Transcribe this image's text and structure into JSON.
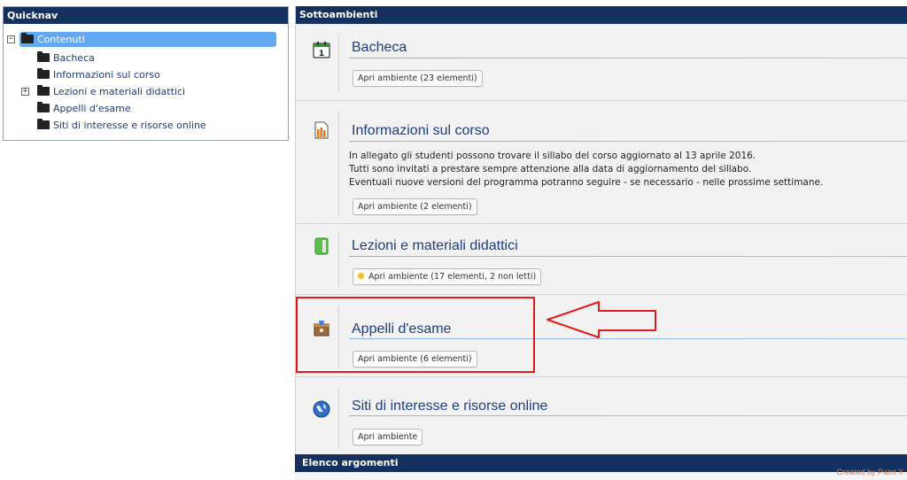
{
  "quicknav": {
    "title": "Quicknav",
    "items": [
      {
        "label": "Contenuti",
        "expander": "−"
      },
      {
        "label": "Bacheca"
      },
      {
        "label": "Informazioni sul corso"
      },
      {
        "label": "Lezioni e materiali didattici",
        "expander": "+"
      },
      {
        "label": "Appelli d'esame"
      },
      {
        "label": "Siti di interesse e risorse online"
      }
    ]
  },
  "sottoambienti": {
    "title": "Sottoambienti",
    "sections": [
      {
        "title": "Bacheca",
        "button": "Apri ambiente (23 elementi)",
        "icon": "calendar-icon"
      },
      {
        "title": "Informazioni sul corso",
        "description": [
          "In allegato gli studenti possono trovare il sillabo del corso aggiornato al 13 aprile 2016.",
          "Tutti sono invitati a prestare sempre attenzione alla data di aggiornamento del sillabo.",
          "Eventuali nuove versioni del programma potranno seguire - se necessario - nelle prossime settimane."
        ],
        "button": "Apri ambiente (2 elementi)",
        "icon": "document-icon"
      },
      {
        "title": "Lezioni e materiali didattici",
        "button": "Apri ambiente (17 elementi, 2 non letti)",
        "icon": "notebook-icon",
        "unread": true
      },
      {
        "title": "Appelli d'esame",
        "button": "Apri ambiente (6 elementi)",
        "icon": "exam-box-icon"
      },
      {
        "title": "Siti di interesse e risorse online",
        "button": "Apri ambiente",
        "icon": "globe-icon"
      }
    ]
  },
  "elenco": {
    "title": "Elenco argomenti"
  },
  "watermark": "Created by Paint X",
  "colors": {
    "header": "#14315e",
    "link": "#1d3f82",
    "annotation": "#e3181c",
    "selection": "#63a8f2"
  }
}
